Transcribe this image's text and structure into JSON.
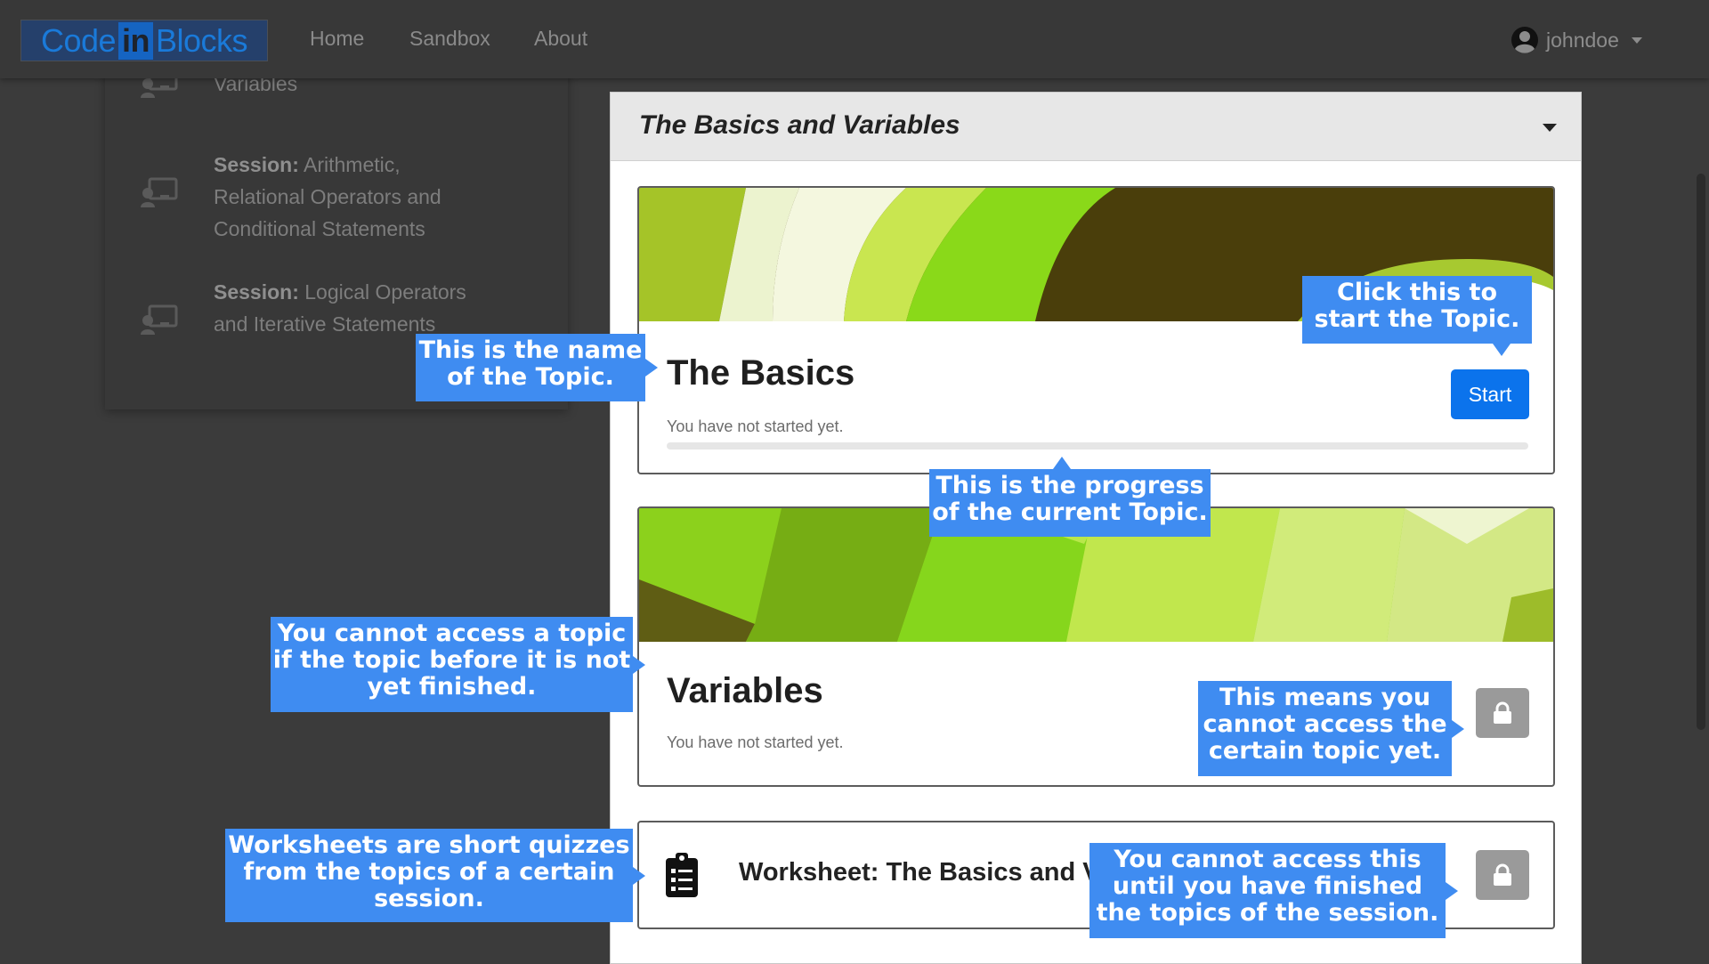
{
  "navbar": {
    "logo": {
      "part1": "Code",
      "part2": "in",
      "part3": "Blocks"
    },
    "links": [
      "Home",
      "Sandbox",
      "About"
    ],
    "user": {
      "name": "johndoe",
      "icon": "user-circle-icon",
      "caret": "chevron-down-icon"
    }
  },
  "sidebar": {
    "items": [
      {
        "prefix": "",
        "text": "Variables",
        "icon": "session-icon"
      },
      {
        "prefix": "Session:",
        "text": "Arithmetic, Relational Operators and Conditional Statements",
        "icon": "session-icon"
      },
      {
        "prefix": "Session:",
        "text": "Logical Operators and Iterative Statements",
        "icon": "session-icon"
      }
    ]
  },
  "panel": {
    "title": "The Basics and Variables",
    "topics": [
      {
        "title": "The Basics",
        "status": "You have not started yet.",
        "progress": 0,
        "action": "Start",
        "locked": false
      },
      {
        "title": "Variables",
        "status": "You have not started yet.",
        "locked": true,
        "lock_icon": "lock-icon"
      }
    ],
    "worksheet": {
      "icon": "clipboard-list-icon",
      "title": "Worksheet: The Basics and V",
      "locked": true,
      "lock_icon": "lock-icon"
    }
  },
  "callouts": {
    "topic_name": "This is the name of the Topic.",
    "start_topic": "Click this to start the Topic.",
    "progress": "This is the progress of the current Topic.",
    "cannot_access_topic": "You cannot access a topic if the topic before it is not yet finished.",
    "lock_meaning": "This means you cannot access the certain topic yet.",
    "worksheets": "Worksheets are short quizzes from the topics of a certain session.",
    "worksheet_locked": "You cannot access this until you have finished the topics of the session."
  },
  "colors": {
    "accent": "#0b73ec",
    "callout": "#3f8cf1",
    "lock": "#9a9a9a",
    "navbar": "#383838"
  }
}
